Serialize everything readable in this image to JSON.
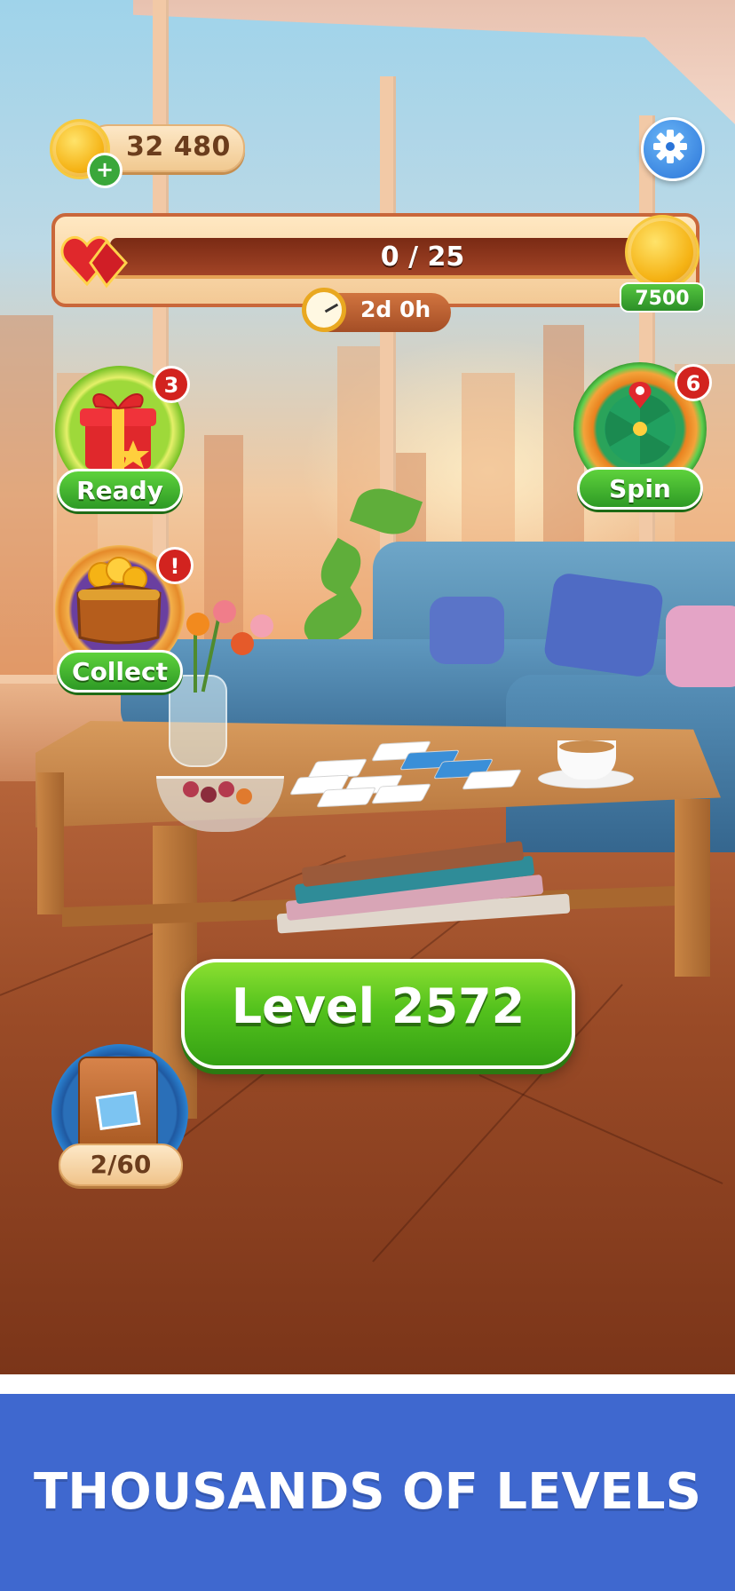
{
  "hud": {
    "coins": "32 480",
    "progress": {
      "value": 0,
      "max": 25,
      "text": "0 / 25"
    },
    "reward_amount": "7500",
    "timer": "2d 0h"
  },
  "side_buttons": {
    "gift": {
      "label": "Ready",
      "badge": "3"
    },
    "wheel": {
      "label": "Spin",
      "badge": "6"
    },
    "purse": {
      "label": "Collect",
      "badge": "!"
    }
  },
  "level_button": {
    "label": "Level 2572"
  },
  "album": {
    "progress": "2/60"
  },
  "banner": {
    "text": "THOUSANDS OF LEVELS"
  },
  "colors": {
    "banner_bg": "#3f68cf",
    "green_button": "#54c21d",
    "coin_gold": "#f5b315"
  },
  "icons": [
    "coin-icon",
    "plus-icon",
    "gear-icon",
    "hearts-icon",
    "stopwatch-icon",
    "gift-icon",
    "wheel-icon",
    "purse-icon",
    "photo-album-icon"
  ]
}
